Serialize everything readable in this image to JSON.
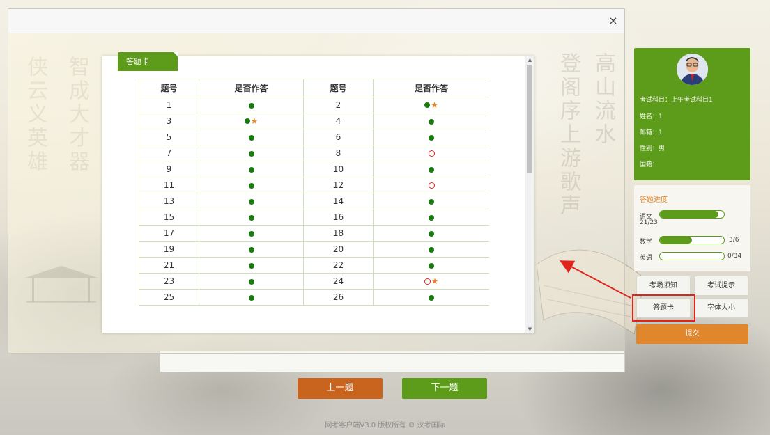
{
  "modal": {
    "close_label": "×",
    "tab_label": "答题卡",
    "table": {
      "headers": [
        "题号",
        "是否作答",
        "题号",
        "是否作答"
      ],
      "rows": [
        [
          {
            "n": "1",
            "s": "answered"
          },
          {
            "n": "2",
            "s": "answered-flagged"
          }
        ],
        [
          {
            "n": "3",
            "s": "answered-flagged"
          },
          {
            "n": "4",
            "s": "answered"
          }
        ],
        [
          {
            "n": "5",
            "s": "answered"
          },
          {
            "n": "6",
            "s": "answered"
          }
        ],
        [
          {
            "n": "7",
            "s": "answered"
          },
          {
            "n": "8",
            "s": "unanswered"
          }
        ],
        [
          {
            "n": "9",
            "s": "answered"
          },
          {
            "n": "10",
            "s": "answered"
          }
        ],
        [
          {
            "n": "11",
            "s": "answered"
          },
          {
            "n": "12",
            "s": "unanswered"
          }
        ],
        [
          {
            "n": "13",
            "s": "answered"
          },
          {
            "n": "14",
            "s": "answered"
          }
        ],
        [
          {
            "n": "15",
            "s": "answered"
          },
          {
            "n": "16",
            "s": "answered"
          }
        ],
        [
          {
            "n": "17",
            "s": "answered"
          },
          {
            "n": "18",
            "s": "answered"
          }
        ],
        [
          {
            "n": "19",
            "s": "answered"
          },
          {
            "n": "20",
            "s": "answered"
          }
        ],
        [
          {
            "n": "21",
            "s": "answered"
          },
          {
            "n": "22",
            "s": "answered"
          }
        ],
        [
          {
            "n": "23",
            "s": "answered"
          },
          {
            "n": "24",
            "s": "unanswered-flagged"
          }
        ],
        [
          {
            "n": "25",
            "s": "answered"
          },
          {
            "n": "26",
            "s": "answered"
          }
        ]
      ]
    }
  },
  "profile": {
    "subject": "考试科目：上午考试科目1",
    "name": "姓名：1",
    "email": "邮箱：1",
    "gender": "性别：男",
    "nationality": "国籍："
  },
  "progress": {
    "title": "答题进度",
    "subjects": [
      {
        "name": "语文",
        "count": "21/23",
        "fraction": 0.913
      },
      {
        "name": "数学",
        "count": "3/6",
        "fraction": 0.5
      },
      {
        "name": "英语",
        "count": "0/34",
        "fraction": 0.0
      }
    ]
  },
  "sidebar_buttons": {
    "exam_notice": "考场须知",
    "exam_tips": "考试提示",
    "answer_card": "答题卡",
    "font_size": "字体大小",
    "submit": "提交"
  },
  "nav": {
    "prev": "上一题",
    "next": "下一题"
  },
  "footer": "网考客户端V3.0 版权所有 © 汉考国际",
  "colors": {
    "green": "#5d9c1b",
    "orange": "#e0862c",
    "prev_button": "#c9641f",
    "answered_dot": "#1a7a10",
    "unanswered_ring": "#e0241c",
    "highlight": "#e0241c"
  },
  "icons": {
    "answered": "filled-green-circle",
    "unanswered": "hollow-red-circle",
    "flagged": "orange-star"
  }
}
